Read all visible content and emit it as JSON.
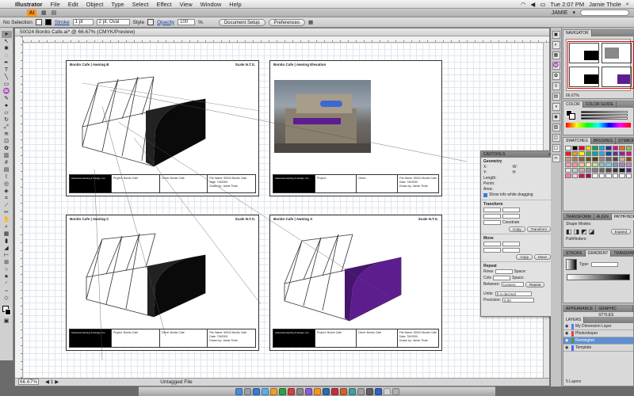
{
  "menubar": {
    "app": "Illustrator",
    "items": [
      "File",
      "Edit",
      "Object",
      "Type",
      "Select",
      "Effect",
      "View",
      "Window",
      "Help"
    ],
    "clock": "Tue 2:07 PM",
    "user": "Jamie Thole"
  },
  "appbar": {
    "logo": "Ai",
    "workspace": "JAMIE"
  },
  "controlbar": {
    "selection": "No Selection",
    "stroke_label": "Stroke",
    "stroke_value": "1 pt",
    "brush_value": "2 pt. Oval",
    "style_label": "Style",
    "opacity_label": "Opacity",
    "opacity_value": "100",
    "opacity_unit": "%",
    "document_setup": "Document Setup",
    "preferences": "Preferences"
  },
  "document": {
    "tab": "50024 Bonito Cafe.ai* @ 66.67% (CMYK/Preview)",
    "zoom": "66.67%",
    "status": "Untagged File"
  },
  "sheets": [
    {
      "title": "Bonito Cafe | Awning B",
      "scale": "Scale N.T.S."
    },
    {
      "title": "Bonito Cafe | Awning Elevation",
      "scale": ""
    },
    {
      "title": "Bonito Cafe | Awning C",
      "scale": "Scale N.T.S."
    },
    {
      "title": "Bonito Cafe | Awning A",
      "scale": "Scale N.T.S."
    }
  ],
  "titleblock": {
    "company": "Advanced Awning & Design, Inc.",
    "project_label": "Project:",
    "client_label": "Client:",
    "file_label": "File Name:",
    "date_label": "Date:",
    "drawn_label": "Drawn by:",
    "client_value": "Bonito Cafe",
    "file_value": "50024 Bonito Cafe",
    "date_value": "7/6/2009",
    "drawn_value": "Jamie Thole"
  },
  "transform_panel": {
    "tab": "CADTOOLS",
    "geometry": "Geometry",
    "length": "Length:",
    "perim": "Perim:",
    "area": "Area:",
    "show_info": "Show info while dragging",
    "transform": "Transform",
    "move": "Move",
    "repeat": "Repeat",
    "rows": "Rows",
    "cols": "Cols",
    "space": "Space:",
    "between": "Between:",
    "between_value": "Centers",
    "units": "Units:",
    "units_value": "ft in decimal",
    "precision": "Precision:",
    "precision_value": "0.00",
    "copy": "Copy",
    "transform_btn": "Transform",
    "move_btn": "Move",
    "repeat_btn": "Repeat",
    "constrain": "Constrain"
  },
  "panels": {
    "navigator": "NAVIGATOR",
    "navigator_zoom": "66.67%",
    "color": "COLOR",
    "color_guide": "COLOR GUIDE",
    "swatches": "SWATCHES",
    "brushes": "BRUSHES",
    "symbols": "SYMBOLS",
    "transform": "TRANSFORM",
    "align": "ALIGN",
    "pathfinder": "PATHFINDER",
    "shape_modes": "Shape Modes:",
    "pathfinders": "Pathfinders:",
    "expand": "Expand",
    "stroke": "STROKE",
    "gradient": "GRADIENT",
    "transparency": "TRANSPARENCY",
    "type_label": "Type:",
    "appearance": "APPEARANCE",
    "graphic_styles": "GRAPHIC STYLES",
    "layers": "LAYERS",
    "layers_count": "5 Layers"
  },
  "layers": [
    {
      "name": "My Dimension Layer",
      "color": "#4f7fff"
    },
    {
      "name": "Photoshoper",
      "color": "#e04040"
    },
    {
      "name": "Remington",
      "color": "#40a040"
    },
    {
      "name": "Template",
      "color": "#4a6aff"
    }
  ],
  "colors": {
    "awning_black": "#0a0a0a",
    "awning_purple": "#5d1d8f"
  }
}
